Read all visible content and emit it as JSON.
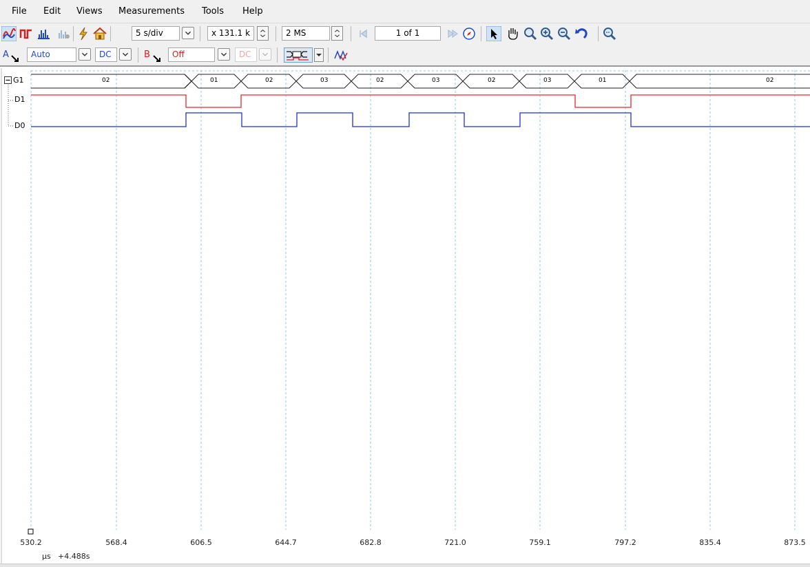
{
  "menu": {
    "file": "File",
    "edit": "Edit",
    "views": "Views",
    "measurements": "Measurements",
    "tools": "Tools",
    "help": "Help"
  },
  "toolbar": {
    "timebase": "5 s/div",
    "zoom": "x 131.1 k",
    "samples": "2 MS",
    "page": "1 of 1"
  },
  "channels_toolbar": {
    "a_label": "A",
    "a_range": "Auto",
    "a_coupling": "DC",
    "b_label": "B",
    "b_range": "Off",
    "b_coupling": "DC"
  },
  "colors": {
    "d1": "#e8262b",
    "d0": "#1d2fd6",
    "grid": "#87cde8",
    "bus": "#222222"
  },
  "traces": {
    "g1": "G1",
    "d1": "D1",
    "d0": "D0",
    "bus_values": [
      "02",
      "01",
      "02",
      "03",
      "02",
      "03",
      "02",
      "03",
      "01",
      "02"
    ]
  },
  "axis": {
    "unit": "μs",
    "offset": "+4.488s",
    "ticks": [
      "530.2",
      "568.4",
      "606.5",
      "644.7",
      "682.8",
      "721.0",
      "759.1",
      "797.2",
      "835.4",
      "873.5"
    ]
  }
}
